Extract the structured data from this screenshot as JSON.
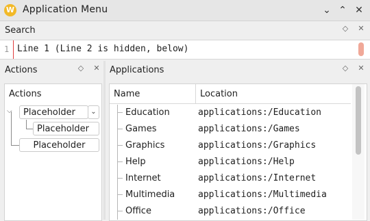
{
  "window": {
    "title": "Application Menu",
    "icon_letter": "W",
    "controls": {
      "minimize": "⌄",
      "maximize": "⌃",
      "close": "✕"
    }
  },
  "search": {
    "title": "Search",
    "line_number": "1",
    "text": "Line 1 (Line 2 is hidden, below)"
  },
  "actions": {
    "title": "Actions",
    "tree_header": "Actions",
    "items": [
      "Placeholder",
      "Placeholder",
      "Placeholder"
    ]
  },
  "applications": {
    "title": "Applications",
    "columns": [
      "Name",
      "Location"
    ],
    "rows": [
      {
        "name": "Education",
        "location": "applications:/Education"
      },
      {
        "name": "Games",
        "location": "applications:/Games"
      },
      {
        "name": "Graphics",
        "location": "applications:/Graphics"
      },
      {
        "name": "Help",
        "location": "applications:/Help"
      },
      {
        "name": "Internet",
        "location": "applications:/Internet"
      },
      {
        "name": "Multimedia",
        "location": "applications:/Multimedia"
      },
      {
        "name": "Office",
        "location": "applications:/Office"
      }
    ]
  },
  "dock_controls": {
    "float": "◇",
    "close": "✕"
  },
  "colors": {
    "accent": "#f2b928",
    "line_rule": "#e03c3c"
  }
}
